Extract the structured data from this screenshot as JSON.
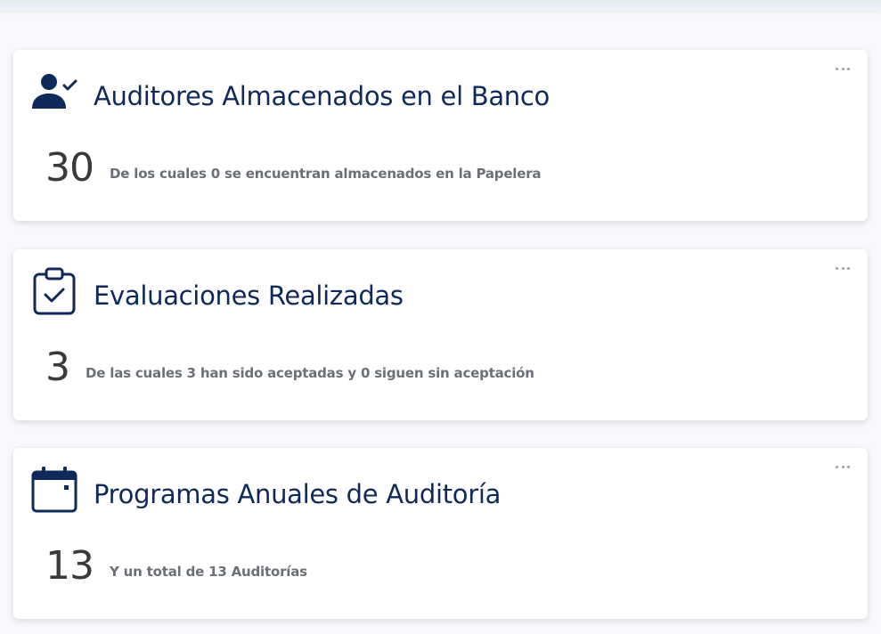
{
  "colors": {
    "title": "#0f2a5a",
    "icon": "#0f2a5a",
    "count": "#3a3a3a",
    "description": "#6b6f76"
  },
  "cards": [
    {
      "icon": "user-check-icon",
      "title": "Auditores Almacenados en el Banco",
      "count": "30",
      "description": "De los cuales 0 se encuentran almacenados en la Papelera"
    },
    {
      "icon": "clipboard-check-icon",
      "title": "Evaluaciones Realizadas",
      "count": "3",
      "description": "De las cuales 3 han sido aceptadas y 0 siguen sin aceptación"
    },
    {
      "icon": "calendar-icon",
      "title": "Programas Anuales de Auditoría",
      "count": "13",
      "description": "Y un total de 13 Auditorías"
    }
  ]
}
